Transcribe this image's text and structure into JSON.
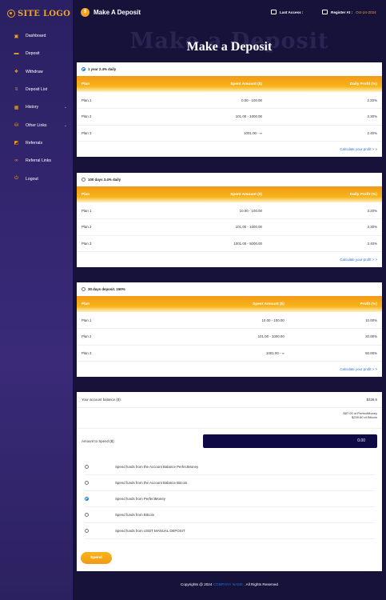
{
  "sidebar": {
    "logo": "SITE LOGO",
    "items": [
      {
        "label": "Dashboard",
        "icon": "dashboard-icon"
      },
      {
        "label": "Deposit",
        "icon": "deposit-icon"
      },
      {
        "label": "Withdraw",
        "icon": "withdraw-icon"
      },
      {
        "label": "Deposit List",
        "icon": "list-icon"
      },
      {
        "label": "History",
        "icon": "history-icon",
        "has_caret": true
      },
      {
        "label": "Other Links",
        "icon": "links-icon",
        "has_caret": true
      },
      {
        "label": "Referrals",
        "icon": "referrals-icon"
      },
      {
        "label": "Referral Links",
        "icon": "referral-links-icon"
      },
      {
        "label": "Logout",
        "icon": "logout-icon"
      }
    ]
  },
  "header": {
    "title": "Make A Deposit",
    "last_access_label": "Last Access :",
    "register_label": "Register At :",
    "register_date": "Oct-24-2024"
  },
  "hero": {
    "ghost": "Make a Deposit",
    "title": "Make a Deposit"
  },
  "plans": [
    {
      "name": "1 year 2.4% daily",
      "selected": true,
      "headers": {
        "plan": "Plan",
        "spent": "Spent Amount ($)",
        "profit": "Daily Profit (%)"
      },
      "rows": [
        {
          "plan": "Plan 1",
          "spent": "0.00 - 100.00",
          "profit": "2.20%"
        },
        {
          "plan": "Plan 2",
          "spent": "101.00 - 1000.00",
          "profit": "2.30%"
        },
        {
          "plan": "Plan 3",
          "spent": "1001.00 - ∞",
          "profit": "2.40%"
        }
      ],
      "calc_link": "Calculate your profit > >"
    },
    {
      "name": "100 days 3.4% daily",
      "selected": false,
      "headers": {
        "plan": "Plan",
        "spent": "Spent Amount ($)",
        "profit": "Daily Profit (%)"
      },
      "rows": [
        {
          "plan": "Plan 1",
          "spent": "10.00 - 100.00",
          "profit": "3.20%"
        },
        {
          "plan": "Plan 2",
          "spent": "101.00 - 1000.00",
          "profit": "3.30%"
        },
        {
          "plan": "Plan 3",
          "spent": "1001.00 - 5000.00",
          "profit": "3.40%"
        }
      ],
      "calc_link": "Calculate your profit > >"
    },
    {
      "name": "30 days deposit. 150%",
      "selected": false,
      "headers": {
        "plan": "Plan",
        "spent": "Spent Amount ($)",
        "profit": "Profit (%)"
      },
      "rows": [
        {
          "plan": "Plan 1",
          "spent": "10.00 - 100.00",
          "profit": "10.00%"
        },
        {
          "plan": "Plan 2",
          "spent": "101.00 - 1000.00",
          "profit": "20.00%"
        },
        {
          "plan": "Plan 3",
          "spent": "1001.00 - ∞",
          "profit": "50.00%"
        }
      ],
      "calc_link": "Calculate your profit > >"
    }
  ],
  "spend": {
    "balance_label": "Your account balance ($):",
    "balance_value": "$326.6",
    "balance_note_1": "$87.00 of PerfectMoney",
    "balance_note_2": "$239.60 of Bitcoin",
    "amount_label": "Amount to Spend ($):",
    "amount_value": "0.00",
    "options": [
      {
        "label": "Spend funds from the Account Balance PerfectMoney",
        "selected": false
      },
      {
        "label": "Spend funds from the Account Balance Bitcoin",
        "selected": false
      },
      {
        "label": "Spend funds from PerfectMoney",
        "selected": true
      },
      {
        "label": "Spend funds from Bitcoin",
        "selected": false
      },
      {
        "label": "Spend funds from USDT MANUAL DEPOSIT",
        "selected": false
      }
    ],
    "button": "Spend"
  },
  "footer": {
    "prefix": "Copyrights @ 2024",
    "company": "COMPANY NAME",
    "suffix": ". All Rights Reserved"
  },
  "colors": {
    "accent": "#f3a323",
    "sidebar": "#2a2063",
    "background": "#16123a",
    "link": "#1e6fd9"
  }
}
